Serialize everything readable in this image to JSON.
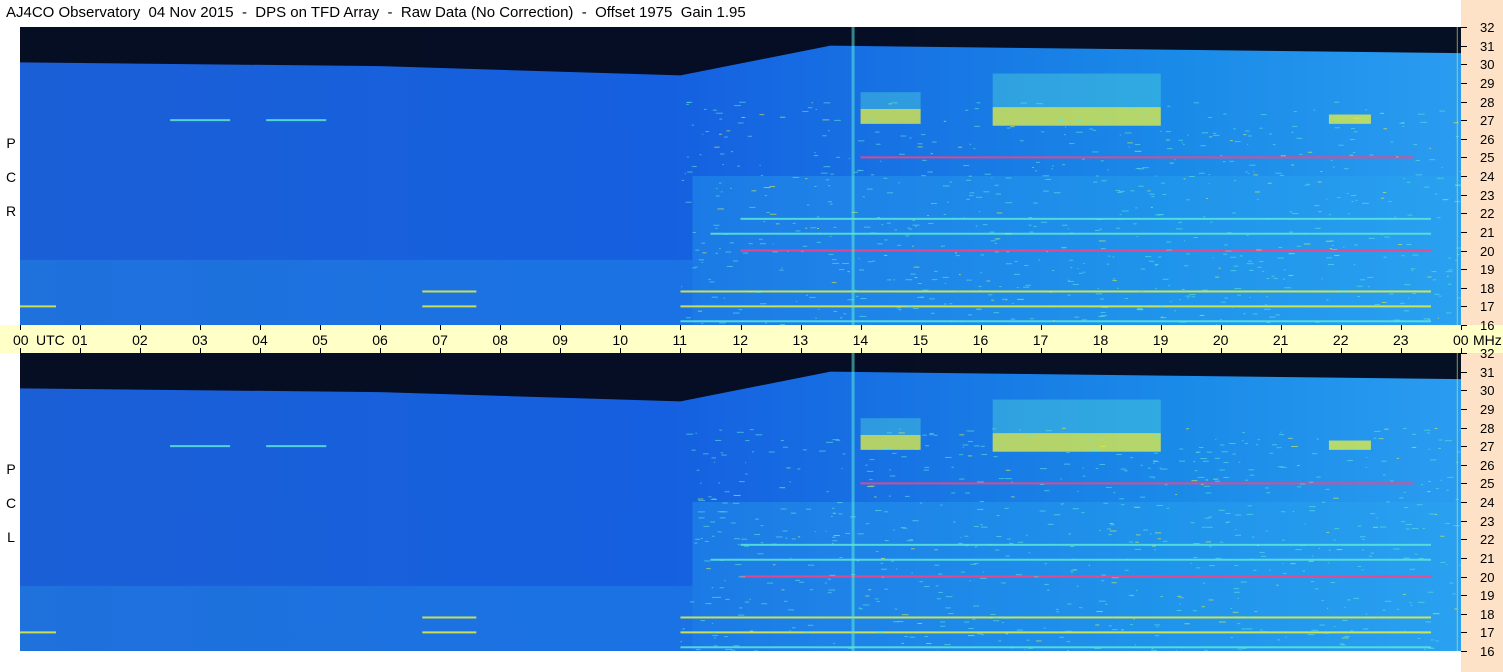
{
  "title": "AJ4CO Observatory  04 Nov 2015  -  DPS on TFD Array  -  Raw Data (No Correction)  -  Offset 1975  Gain 1.95",
  "chart_data": {
    "type": "heatmap",
    "title": "AJ4CO Observatory  04 Nov 2015  -  DPS on TFD Array  -  Raw Data (No Correction)  -  Offset 1975  Gain 1.95",
    "panels": [
      {
        "label_letters": [
          "R",
          "C",
          "P"
        ]
      },
      {
        "label_letters": [
          "L",
          "C",
          "P"
        ]
      }
    ],
    "x_unit": "UTC",
    "x_ticks": [
      "00",
      "01",
      "02",
      "03",
      "04",
      "05",
      "06",
      "07",
      "08",
      "09",
      "10",
      "11",
      "12",
      "13",
      "14",
      "15",
      "16",
      "17",
      "18",
      "19",
      "20",
      "21",
      "22",
      "23",
      "00"
    ],
    "xlim_hours": [
      0,
      24
    ],
    "y_unit": "MHz",
    "y_ticks": [
      "32",
      "31",
      "30",
      "29",
      "28",
      "27",
      "26",
      "25",
      "24",
      "23",
      "22",
      "21",
      "20",
      "19",
      "18",
      "17",
      "16"
    ],
    "ylim_mhz": [
      16,
      32
    ],
    "colors": {
      "background": "#1560e0",
      "night": "#050a1c",
      "noise": "#2aa8f0",
      "signal_cyan": "#5ce8d8",
      "signal_yellow": "#e8f040",
      "signal_red": "#ff4080"
    }
  }
}
